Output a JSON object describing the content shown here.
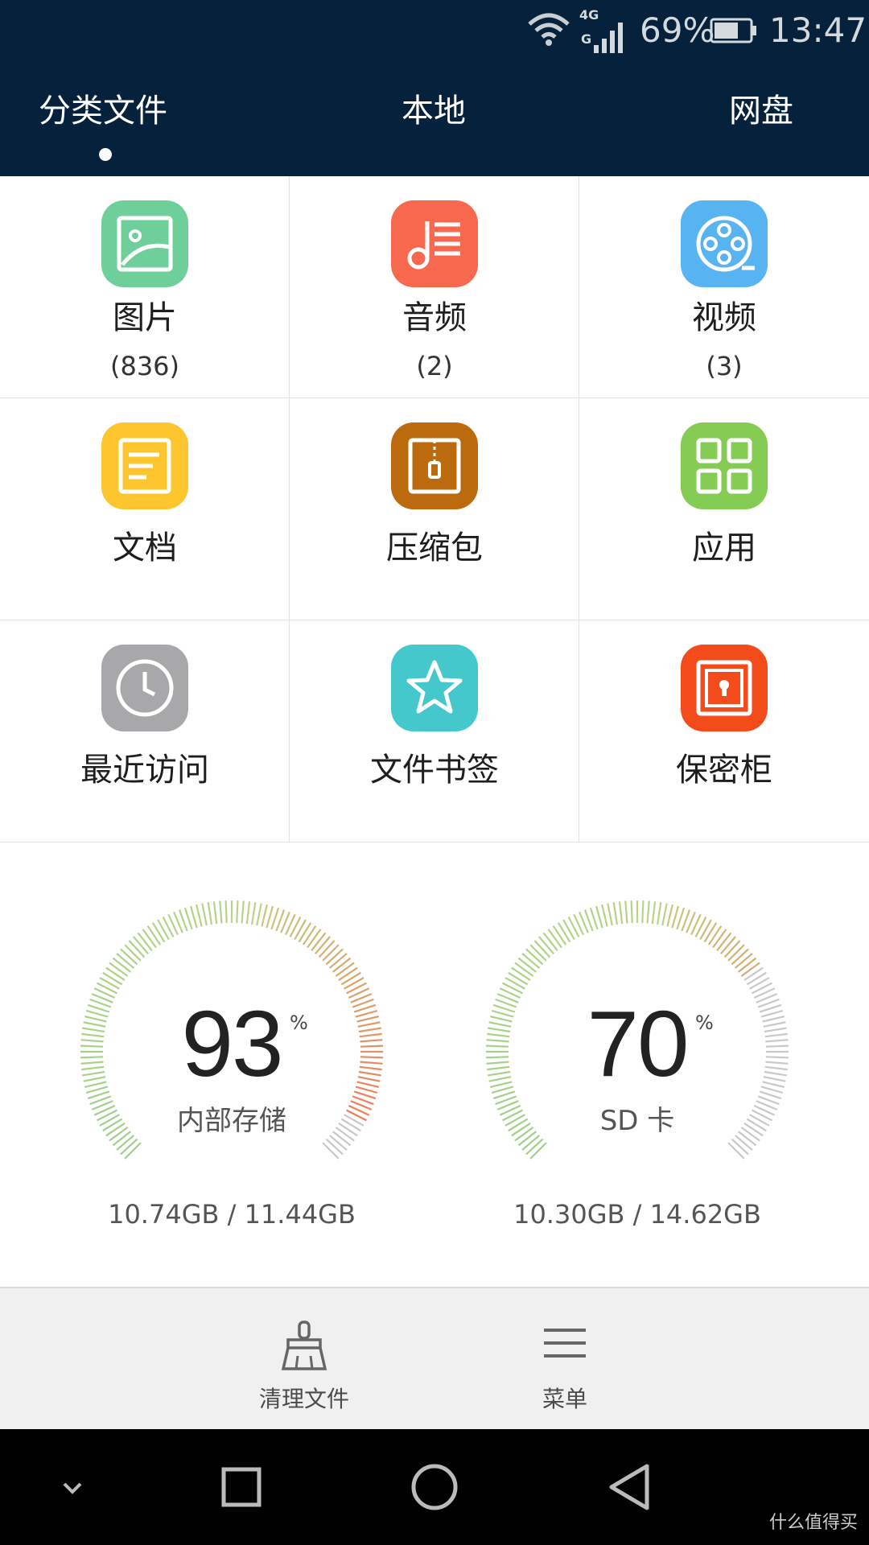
{
  "status_bar": {
    "network": "4G",
    "battery_percent": "69%",
    "battery_level": 0.69,
    "time": "13:47"
  },
  "header": {
    "tabs": [
      {
        "label": "分类文件",
        "active": true
      },
      {
        "label": "本地",
        "active": false
      },
      {
        "label": "网盘",
        "active": false
      }
    ]
  },
  "categories": [
    {
      "label": "图片",
      "count": "(836)",
      "icon": "image-icon",
      "color": "#6fcf9b"
    },
    {
      "label": "音频",
      "count": "(2)",
      "icon": "music-icon",
      "color": "#f8684f"
    },
    {
      "label": "视频",
      "count": "(3)",
      "icon": "film-reel-icon",
      "color": "#58b4f1"
    },
    {
      "label": "文档",
      "icon": "document-icon",
      "color": "#fdc52e"
    },
    {
      "label": "压缩包",
      "icon": "zip-archive-icon",
      "color": "#bb6a0e"
    },
    {
      "label": "应用",
      "icon": "apps-grid-icon",
      "color": "#85cc55"
    },
    {
      "label": "最近访问",
      "icon": "clock-icon",
      "color": "#a8a8aa"
    },
    {
      "label": "文件书签",
      "icon": "star-icon",
      "color": "#45c8cc"
    },
    {
      "label": "保密柜",
      "icon": "safe-icon",
      "color": "#f44b1b"
    }
  ],
  "storage": [
    {
      "name": "内部存储",
      "percent": "93",
      "percent_value": 93,
      "unit": "%",
      "usage": "10.74GB / 11.44GB"
    },
    {
      "name": "SD 卡",
      "percent": "70",
      "percent_value": 70,
      "unit": "%",
      "usage": "10.30GB / 14.62GB"
    }
  ],
  "actions": {
    "clean": {
      "label": "清理文件",
      "icon": "broom-icon"
    },
    "menu": {
      "label": "菜单",
      "icon": "menu-icon"
    }
  },
  "nav": {
    "icons": [
      "hide-keyboard-icon",
      "recents-icon",
      "home-icon",
      "back-icon"
    ]
  },
  "watermark": "什么值得买"
}
